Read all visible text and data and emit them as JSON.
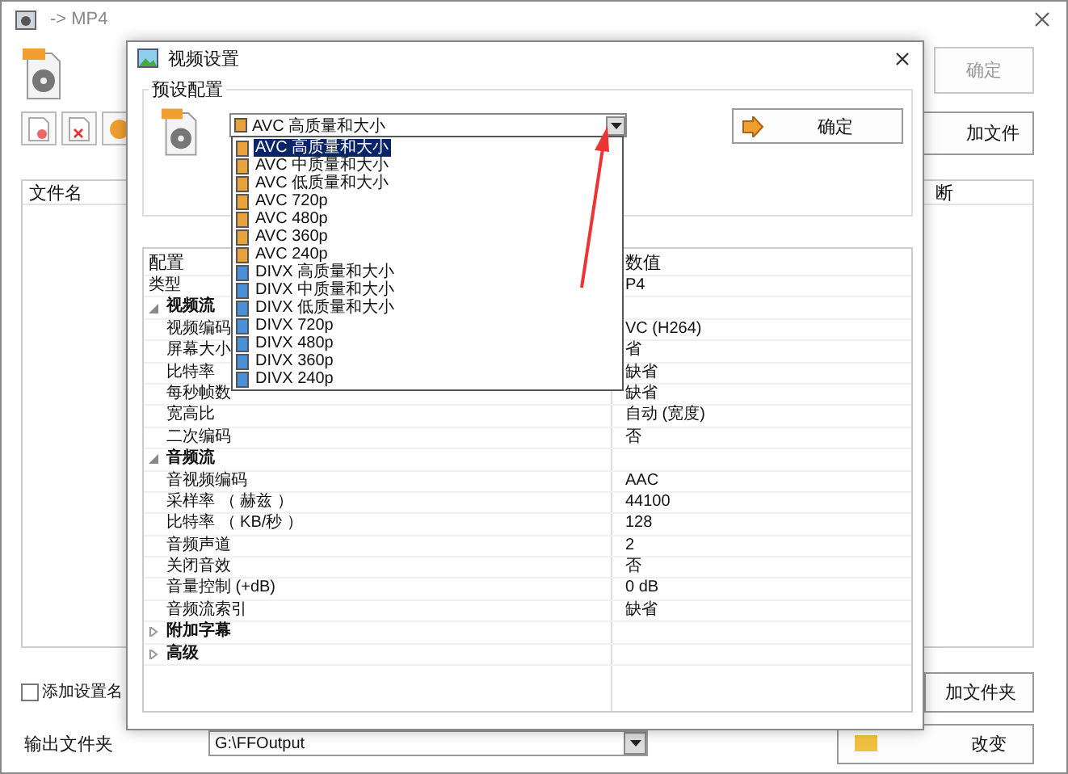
{
  "main_window": {
    "title": "-> MP4",
    "confirm_button": {
      "label": "确定",
      "disabled": true
    },
    "add_file_button": "加文件",
    "file_list": {
      "columns": [
        "文件名",
        "断"
      ]
    },
    "add_setting_name": {
      "label": "添加设置名",
      "checked": false
    },
    "add_folder_button": "加文件夹",
    "output_folder": {
      "label": "输出文件夹",
      "value": "G:\\FFOutput"
    },
    "change_button": "改变"
  },
  "dialog": {
    "title": "视频设置",
    "preset_group": {
      "title": "预设配置",
      "preset": "AVC 高质量和大小",
      "confirm_button": "确定",
      "options": [
        {
          "label": "AVC 高质量和大小",
          "color": "#e8a33c",
          "selected": true
        },
        {
          "label": "AVC 中质量和大小",
          "color": "#e8a33c",
          "selected": false
        },
        {
          "label": "AVC 低质量和大小",
          "color": "#e8a33c",
          "selected": false
        },
        {
          "label": "AVC 720p",
          "color": "#e8a33c",
          "selected": false
        },
        {
          "label": "AVC 480p",
          "color": "#e8a33c",
          "selected": false
        },
        {
          "label": "AVC 360p",
          "color": "#e8a33c",
          "selected": false
        },
        {
          "label": "AVC 240p",
          "color": "#e8a33c",
          "selected": false
        },
        {
          "label": "DIVX 高质量和大小",
          "color": "#4a90d9",
          "selected": false
        },
        {
          "label": "DIVX 中质量和大小",
          "color": "#4a90d9",
          "selected": false
        },
        {
          "label": "DIVX 低质量和大小",
          "color": "#4a90d9",
          "selected": false
        },
        {
          "label": "DIVX 720p",
          "color": "#4a90d9",
          "selected": false
        },
        {
          "label": "DIVX 480p",
          "color": "#4a90d9",
          "selected": false
        },
        {
          "label": "DIVX 360p",
          "color": "#4a90d9",
          "selected": false
        },
        {
          "label": "DIVX 240p",
          "color": "#4a90d9",
          "selected": false
        }
      ]
    },
    "grid": {
      "columns": [
        "配置",
        "数值"
      ],
      "rows": [
        {
          "kind": "row",
          "label": "类型",
          "value": "P4"
        },
        {
          "kind": "group",
          "label": "视频流",
          "expanded": true,
          "children": [
            {
              "kind": "row",
              "label": "视频编码",
              "value": "VC (H264)"
            },
            {
              "kind": "row",
              "label": "屏幕大小",
              "value": "省"
            },
            {
              "kind": "row",
              "label": "比特率",
              "value": "缺省"
            },
            {
              "kind": "row",
              "label": "每秒帧数",
              "value": "缺省"
            },
            {
              "kind": "row",
              "label": "宽高比",
              "value": "自动 (宽度)"
            },
            {
              "kind": "row",
              "label": "二次编码",
              "value": "否"
            }
          ]
        },
        {
          "kind": "group",
          "label": "音频流",
          "expanded": true,
          "children": [
            {
              "kind": "row",
              "label": "音视频编码",
              "value": "AAC"
            },
            {
              "kind": "row",
              "label": "采样率 （ 赫兹 ）",
              "value": "44100"
            },
            {
              "kind": "row",
              "label": "比特率 （ KB/秒 ）",
              "value": "128"
            },
            {
              "kind": "row",
              "label": "音频声道",
              "value": "2"
            },
            {
              "kind": "row",
              "label": "关闭音效",
              "value": "否"
            },
            {
              "kind": "row",
              "label": "音量控制 (+dB)",
              "value": "0 dB"
            },
            {
              "kind": "row",
              "label": "音频流索引",
              "value": "缺省"
            }
          ]
        },
        {
          "kind": "group",
          "label": "附加字幕",
          "expanded": false,
          "children": []
        },
        {
          "kind": "group",
          "label": "高级",
          "expanded": false,
          "children": []
        }
      ]
    }
  }
}
